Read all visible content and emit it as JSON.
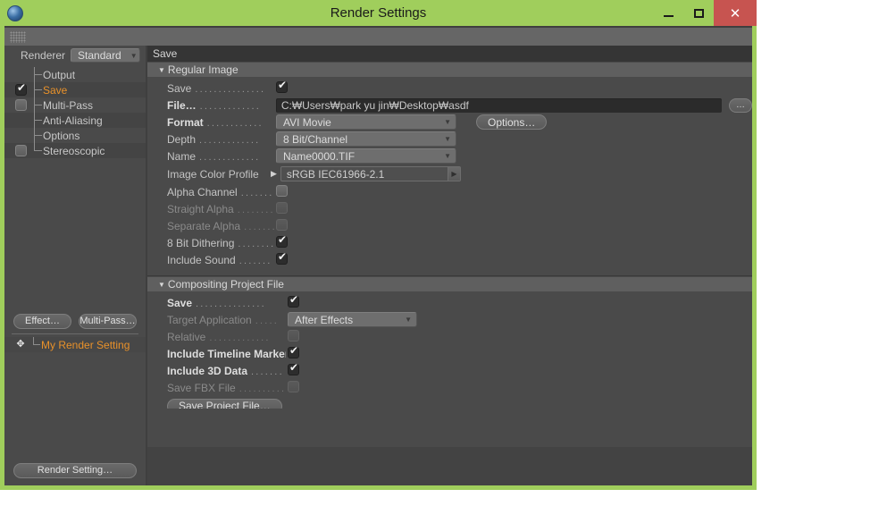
{
  "window": {
    "title": "Render Settings",
    "app_icon": "c4d-sphere-icon",
    "controls": {
      "minimize": "minimize-icon",
      "maximize": "maximize-icon",
      "close": "✕"
    },
    "accent_color": "#a0ce5c",
    "close_color": "#c75450"
  },
  "left_pane": {
    "renderer_label": "Renderer",
    "renderer_value": "Standard",
    "tree": [
      {
        "label": "Output",
        "checkbox": "none",
        "selected": false
      },
      {
        "label": "Save",
        "checkbox": "checked",
        "selected": true
      },
      {
        "label": "Multi-Pass",
        "checkbox": "off",
        "selected": false
      },
      {
        "label": "Anti-Aliasing",
        "checkbox": "none",
        "selected": false
      },
      {
        "label": "Options",
        "checkbox": "none",
        "selected": false
      },
      {
        "label": "Stereoscopic",
        "checkbox": "off",
        "selected": false
      }
    ],
    "effect_button": "Effect…",
    "multipass_button": "Multi-Pass…",
    "render_setting_name": "My Render Setting",
    "render_setting_icon": "target-icon",
    "render_setting_button": "Render Setting…"
  },
  "right_pane": {
    "pane_title": "Save",
    "regular_image": {
      "header": "Regular Image",
      "save_label": "Save",
      "save_checked": true,
      "file_label": "File…",
      "file_value": "C:₩Users₩park yu jin₩Desktop₩asdf",
      "browse_label": "…",
      "format_label": "Format",
      "format_value": "AVI Movie",
      "options_button": "Options…",
      "depth_label": "Depth",
      "depth_value": "8 Bit/Channel",
      "name_label": "Name",
      "name_value": "Name0000.TIF",
      "color_profile_label": "Image Color Profile",
      "color_profile_value": "sRGB IEC61966-2.1",
      "alpha_channel_label": "Alpha Channel",
      "alpha_channel_checked": false,
      "straight_alpha_label": "Straight Alpha",
      "straight_alpha_checked": false,
      "separate_alpha_label": "Separate Alpha",
      "separate_alpha_checked": false,
      "dithering_label": "8 Bit Dithering",
      "dithering_checked": true,
      "include_sound_label": "Include Sound",
      "include_sound_checked": true
    },
    "compositing": {
      "header": "Compositing Project File",
      "save_label": "Save",
      "save_checked": true,
      "target_app_label": "Target Application",
      "target_app_value": "After Effects",
      "relative_label": "Relative",
      "relative_checked": false,
      "timeline_marker_label": "Include Timeline Marker",
      "timeline_marker_checked": true,
      "include_3d_label": "Include 3D Data",
      "include_3d_checked": true,
      "fbx_label": "Save FBX File",
      "fbx_checked": false,
      "save_project_button": "Save Project File…"
    }
  }
}
